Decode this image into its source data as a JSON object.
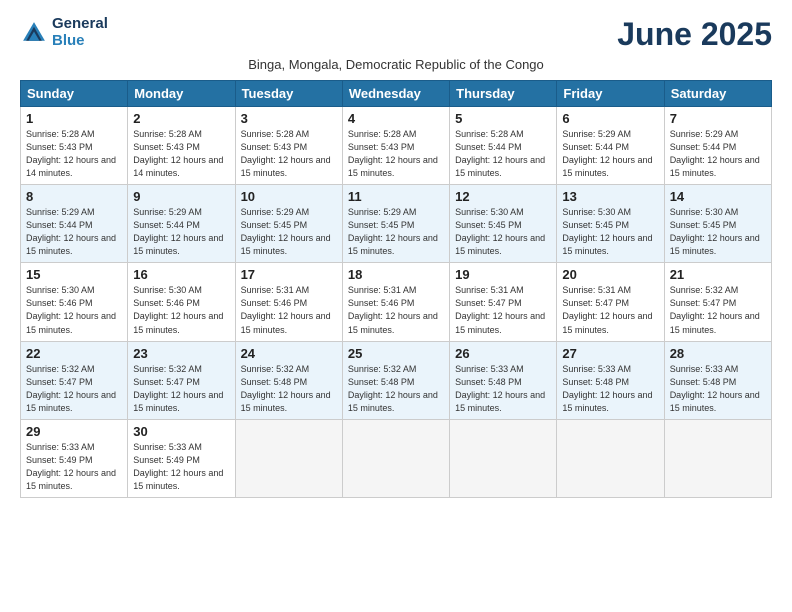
{
  "logo": {
    "line1": "General",
    "line2": "Blue"
  },
  "title": "June 2025",
  "subtitle": "Binga, Mongala, Democratic Republic of the Congo",
  "headers": [
    "Sunday",
    "Monday",
    "Tuesday",
    "Wednesday",
    "Thursday",
    "Friday",
    "Saturday"
  ],
  "weeks": [
    [
      {
        "day": "1",
        "sunrise": "5:28 AM",
        "sunset": "5:43 PM",
        "daylight": "12 hours and 14 minutes."
      },
      {
        "day": "2",
        "sunrise": "5:28 AM",
        "sunset": "5:43 PM",
        "daylight": "12 hours and 14 minutes."
      },
      {
        "day": "3",
        "sunrise": "5:28 AM",
        "sunset": "5:43 PM",
        "daylight": "12 hours and 15 minutes."
      },
      {
        "day": "4",
        "sunrise": "5:28 AM",
        "sunset": "5:43 PM",
        "daylight": "12 hours and 15 minutes."
      },
      {
        "day": "5",
        "sunrise": "5:28 AM",
        "sunset": "5:44 PM",
        "daylight": "12 hours and 15 minutes."
      },
      {
        "day": "6",
        "sunrise": "5:29 AM",
        "sunset": "5:44 PM",
        "daylight": "12 hours and 15 minutes."
      },
      {
        "day": "7",
        "sunrise": "5:29 AM",
        "sunset": "5:44 PM",
        "daylight": "12 hours and 15 minutes."
      }
    ],
    [
      {
        "day": "8",
        "sunrise": "5:29 AM",
        "sunset": "5:44 PM",
        "daylight": "12 hours and 15 minutes."
      },
      {
        "day": "9",
        "sunrise": "5:29 AM",
        "sunset": "5:44 PM",
        "daylight": "12 hours and 15 minutes."
      },
      {
        "day": "10",
        "sunrise": "5:29 AM",
        "sunset": "5:45 PM",
        "daylight": "12 hours and 15 minutes."
      },
      {
        "day": "11",
        "sunrise": "5:29 AM",
        "sunset": "5:45 PM",
        "daylight": "12 hours and 15 minutes."
      },
      {
        "day": "12",
        "sunrise": "5:30 AM",
        "sunset": "5:45 PM",
        "daylight": "12 hours and 15 minutes."
      },
      {
        "day": "13",
        "sunrise": "5:30 AM",
        "sunset": "5:45 PM",
        "daylight": "12 hours and 15 minutes."
      },
      {
        "day": "14",
        "sunrise": "5:30 AM",
        "sunset": "5:45 PM",
        "daylight": "12 hours and 15 minutes."
      }
    ],
    [
      {
        "day": "15",
        "sunrise": "5:30 AM",
        "sunset": "5:46 PM",
        "daylight": "12 hours and 15 minutes."
      },
      {
        "day": "16",
        "sunrise": "5:30 AM",
        "sunset": "5:46 PM",
        "daylight": "12 hours and 15 minutes."
      },
      {
        "day": "17",
        "sunrise": "5:31 AM",
        "sunset": "5:46 PM",
        "daylight": "12 hours and 15 minutes."
      },
      {
        "day": "18",
        "sunrise": "5:31 AM",
        "sunset": "5:46 PM",
        "daylight": "12 hours and 15 minutes."
      },
      {
        "day": "19",
        "sunrise": "5:31 AM",
        "sunset": "5:47 PM",
        "daylight": "12 hours and 15 minutes."
      },
      {
        "day": "20",
        "sunrise": "5:31 AM",
        "sunset": "5:47 PM",
        "daylight": "12 hours and 15 minutes."
      },
      {
        "day": "21",
        "sunrise": "5:32 AM",
        "sunset": "5:47 PM",
        "daylight": "12 hours and 15 minutes."
      }
    ],
    [
      {
        "day": "22",
        "sunrise": "5:32 AM",
        "sunset": "5:47 PM",
        "daylight": "12 hours and 15 minutes."
      },
      {
        "day": "23",
        "sunrise": "5:32 AM",
        "sunset": "5:47 PM",
        "daylight": "12 hours and 15 minutes."
      },
      {
        "day": "24",
        "sunrise": "5:32 AM",
        "sunset": "5:48 PM",
        "daylight": "12 hours and 15 minutes."
      },
      {
        "day": "25",
        "sunrise": "5:32 AM",
        "sunset": "5:48 PM",
        "daylight": "12 hours and 15 minutes."
      },
      {
        "day": "26",
        "sunrise": "5:33 AM",
        "sunset": "5:48 PM",
        "daylight": "12 hours and 15 minutes."
      },
      {
        "day": "27",
        "sunrise": "5:33 AM",
        "sunset": "5:48 PM",
        "daylight": "12 hours and 15 minutes."
      },
      {
        "day": "28",
        "sunrise": "5:33 AM",
        "sunset": "5:48 PM",
        "daylight": "12 hours and 15 minutes."
      }
    ],
    [
      {
        "day": "29",
        "sunrise": "5:33 AM",
        "sunset": "5:49 PM",
        "daylight": "12 hours and 15 minutes."
      },
      {
        "day": "30",
        "sunrise": "5:33 AM",
        "sunset": "5:49 PM",
        "daylight": "12 hours and 15 minutes."
      },
      null,
      null,
      null,
      null,
      null
    ]
  ]
}
